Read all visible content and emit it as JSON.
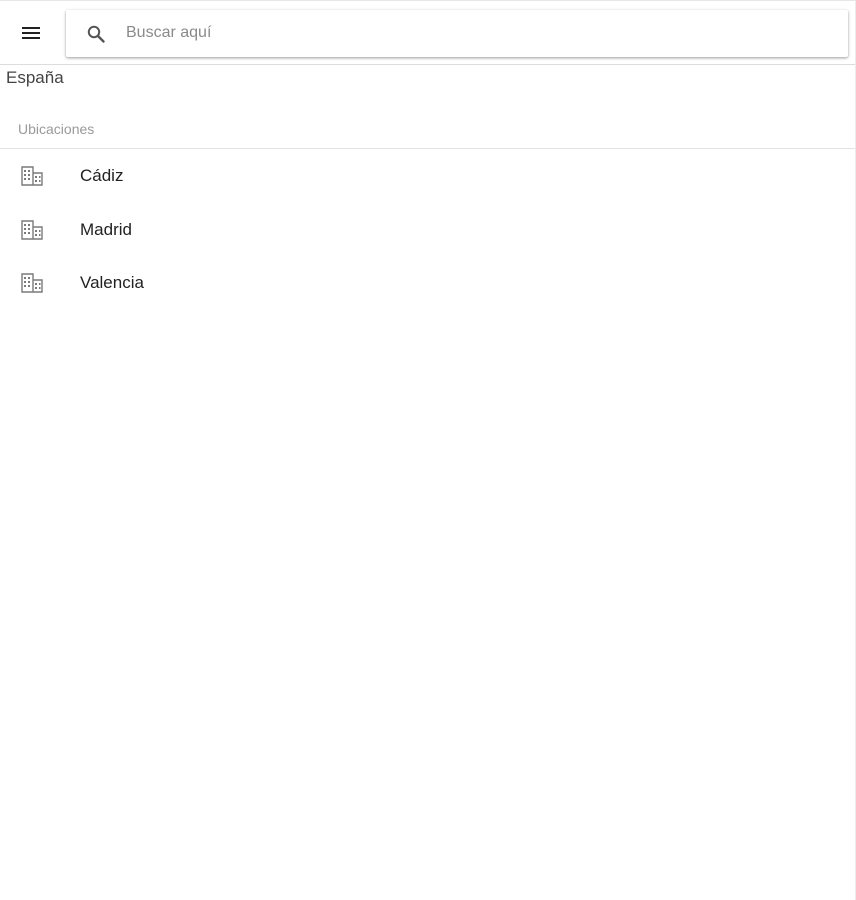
{
  "header": {
    "menu_icon": "menu-icon",
    "search": {
      "icon": "search-icon",
      "placeholder": "Buscar aquí",
      "value": ""
    }
  },
  "region": {
    "title": "España"
  },
  "locations": {
    "section_label": "Ubicaciones",
    "item_icon": "building-icon",
    "items": [
      {
        "label": "Cádiz"
      },
      {
        "label": "Madrid"
      },
      {
        "label": "Valencia"
      }
    ]
  },
  "colors": {
    "icon": "#757575",
    "text": "#222222",
    "muted": "#9a9a9a"
  }
}
